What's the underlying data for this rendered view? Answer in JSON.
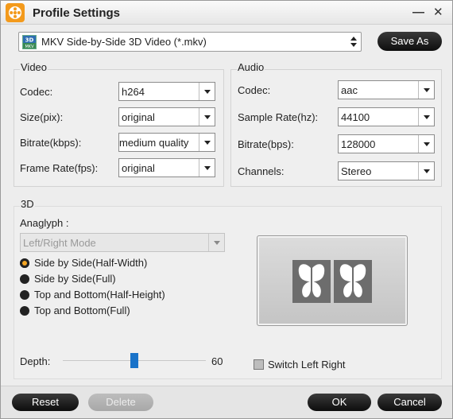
{
  "window": {
    "title": "Profile Settings"
  },
  "profile": {
    "selected": "MKV Side-by-Side 3D Video (*.mkv)",
    "save_as_label": "Save As"
  },
  "video": {
    "group_title": "Video",
    "codec_label": "Codec:",
    "codec_value": "h264",
    "size_label": "Size(pix):",
    "size_value": "original",
    "bitrate_label": "Bitrate(kbps):",
    "bitrate_value": "medium quality",
    "framerate_label": "Frame Rate(fps):",
    "framerate_value": "original"
  },
  "audio": {
    "group_title": "Audio",
    "codec_label": "Codec:",
    "codec_value": "aac",
    "samplerate_label": "Sample Rate(hz):",
    "samplerate_value": "44100",
    "bitrate_label": "Bitrate(bps):",
    "bitrate_value": "128000",
    "channels_label": "Channels:",
    "channels_value": "Stereo"
  },
  "three_d": {
    "group_title": "3D",
    "anaglyph_label": "Anaglyph :",
    "anaglyph_value": "Left/Right Mode",
    "modes": [
      {
        "label": "Side by Side(Half-Width)",
        "selected": true
      },
      {
        "label": "Side by Side(Full)",
        "selected": false
      },
      {
        "label": "Top and Bottom(Half-Height)",
        "selected": false
      },
      {
        "label": "Top and Bottom(Full)",
        "selected": false
      }
    ],
    "depth_label": "Depth:",
    "depth_value": "60",
    "switch_label": "Switch Left Right",
    "switch_checked": false
  },
  "footer": {
    "reset_label": "Reset",
    "delete_label": "Delete",
    "ok_label": "OK",
    "cancel_label": "Cancel"
  },
  "icons": {
    "app": "film-reel-icon",
    "minimize": "minimize-icon",
    "close": "close-icon",
    "preview": "butterfly-pair-icon"
  },
  "colors": {
    "accent": "#f39a1c",
    "slider": "#1a73c9",
    "button": "#1a1a1a"
  }
}
